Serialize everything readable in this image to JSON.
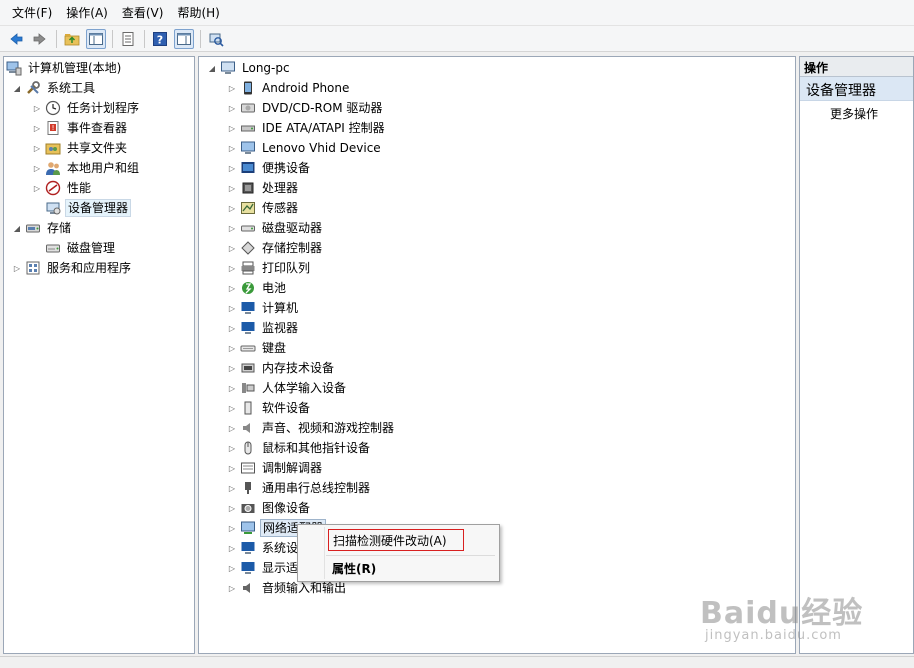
{
  "menubar": {
    "items": [
      "文件(F)",
      "操作(A)",
      "查看(V)",
      "帮助(H)"
    ]
  },
  "toolbar": {
    "buttons": [
      "back-icon",
      "forward-icon",
      "up-folder-icon",
      "show-hide-console-tree-icon",
      "export-list-icon",
      "help-icon",
      "action-pane-icon",
      "scan-hardware-icon"
    ]
  },
  "left_tree": {
    "root": "计算机管理(本地)",
    "system_tools": "系统工具",
    "task_scheduler": "任务计划程序",
    "event_viewer": "事件查看器",
    "shared_folders": "共享文件夹",
    "local_users": "本地用户和组",
    "performance": "性能",
    "device_manager": "设备管理器",
    "storage": "存储",
    "disk_management": "磁盘管理",
    "services_apps": "服务和应用程序"
  },
  "device_tree": {
    "root": "Long-pc",
    "items": [
      "Android Phone",
      "DVD/CD-ROM 驱动器",
      "IDE ATA/ATAPI 控制器",
      "Lenovo Vhid Device",
      "便携设备",
      "处理器",
      "传感器",
      "磁盘驱动器",
      "存储控制器",
      "打印队列",
      "电池",
      "计算机",
      "监视器",
      "键盘",
      "内存技术设备",
      "人体学输入设备",
      "软件设备",
      "声音、视频和游戏控制器",
      "鼠标和其他指针设备",
      "调制解调器",
      "通用串行总线控制器",
      "图像设备",
      "网络适配器",
      "系统设备",
      "显示适配器",
      "音频输入和输出"
    ]
  },
  "right_pane": {
    "header": "操作",
    "title": "设备管理器",
    "more_actions": "更多操作"
  },
  "context_menu": {
    "scan": "扫描检测硬件改动(A)",
    "properties": "属性(R)"
  },
  "watermark": {
    "logo": "Baidu经验",
    "url": "jingyan.baidu.com"
  }
}
